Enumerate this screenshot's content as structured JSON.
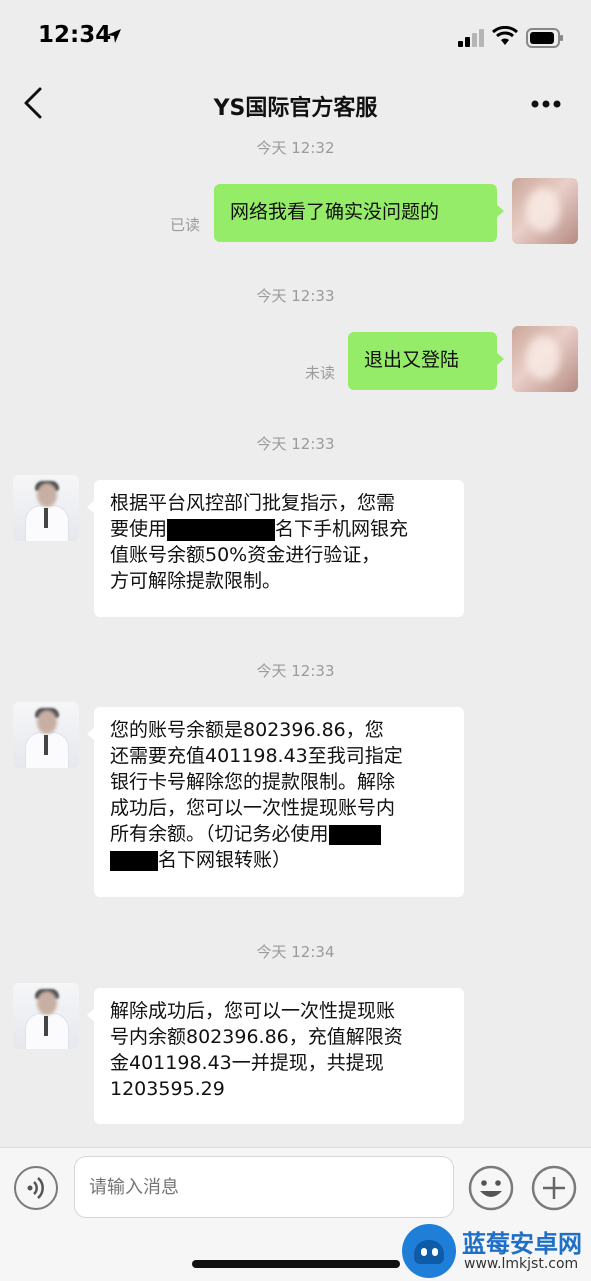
{
  "status_bar": {
    "time": "12:34"
  },
  "header": {
    "title": "YS国际官方客服"
  },
  "messages": [
    {
      "type": "timestamp",
      "text": "今天 12:32"
    },
    {
      "type": "outgoing",
      "text": "网络我看了确实没问题的",
      "read_state": "已读"
    },
    {
      "type": "timestamp",
      "text": "今天 12:33"
    },
    {
      "type": "outgoing",
      "text": "退出又登陆",
      "read_state": "未读"
    },
    {
      "type": "timestamp",
      "text": "今天 12:33"
    },
    {
      "type": "incoming",
      "text_a": "根据平台风控部门批复指示，您需\n要使用",
      "text_b": "名下手机网银充\n值账号余额50%资金进行验证，\n方可解除提款限制。"
    },
    {
      "type": "timestamp",
      "text": "今天 12:33"
    },
    {
      "type": "incoming",
      "text_a": "您的账号余额是802396.86，您\n还需要充值401198.43至我司指定\n银行卡号解除您的提款限制。解除\n成功后，您可以一次性提现账号内\n所有余额。（切记务必使用",
      "text_b": "名下网银转账）"
    },
    {
      "type": "timestamp",
      "text": "今天 12:34"
    },
    {
      "type": "incoming",
      "text": "解除成功后，您可以一次性提现账\n号内余额802396.86，充值解限资\n金401198.43一并提现，共提现\n1203595.29"
    }
  ],
  "input_bar": {
    "placeholder": "请输入消息"
  },
  "watermark": {
    "brand": "蓝莓安卓网",
    "url": "www.lmkjst.com"
  },
  "colors": {
    "background": "#ededed",
    "outgoing_bubble": "#95ec69",
    "incoming_bubble": "#ffffff",
    "meta_text": "#9b9b9b",
    "brand_blue": "#1f6fc7"
  },
  "icons": [
    "location-arrow-icon",
    "signal-icon",
    "wifi-icon",
    "battery-icon",
    "back-chevron-icon",
    "more-dots-icon",
    "voice-icon",
    "emoji-icon",
    "plus-icon"
  ]
}
